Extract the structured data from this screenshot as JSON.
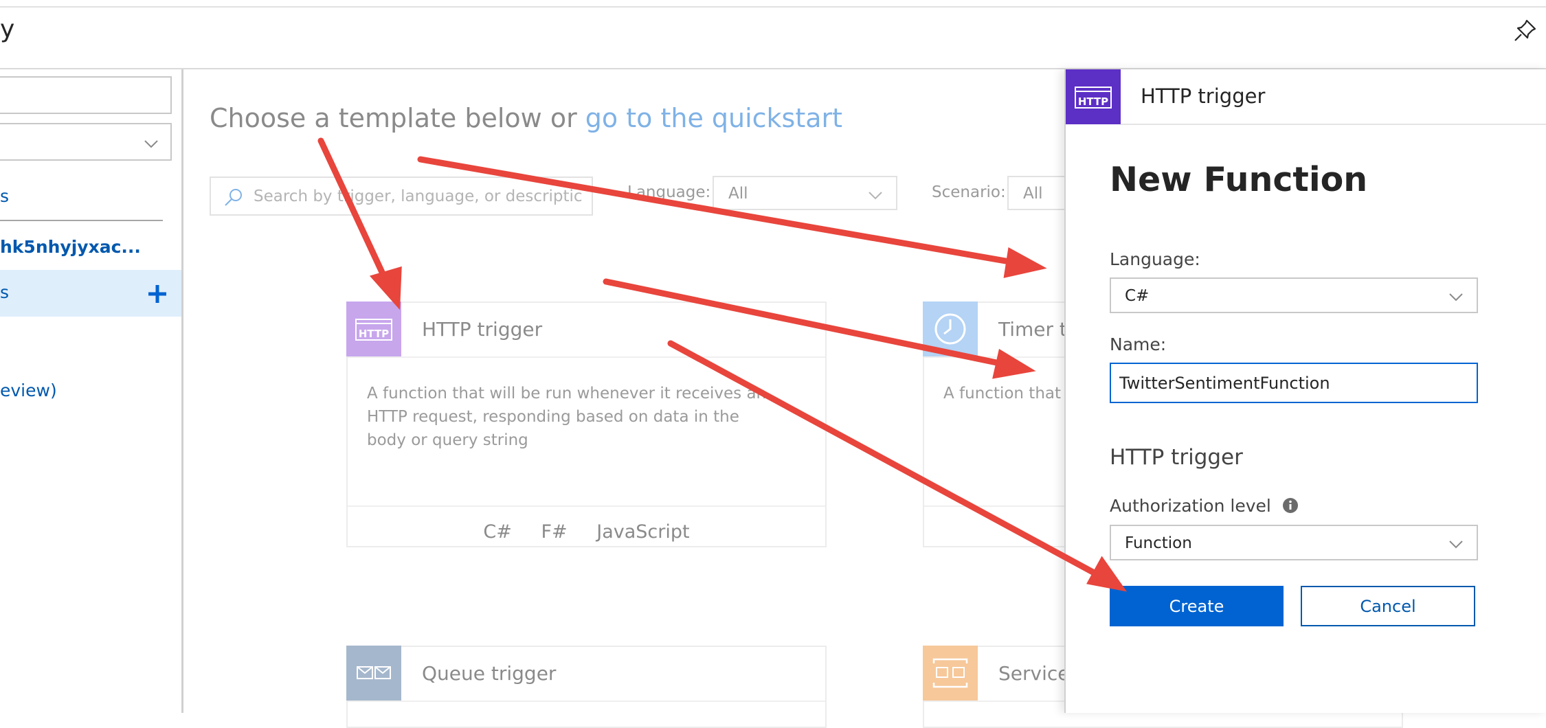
{
  "topbar": {
    "title_fragment": "y"
  },
  "sidebar": {
    "items": [
      {
        "label": "s"
      },
      {
        "label": "hk5nhyjyxac..."
      },
      {
        "label": "s"
      },
      {
        "label": "eview)"
      }
    ]
  },
  "main": {
    "heading_text": "Choose a template below or ",
    "heading_link": "go to the quickstart",
    "search_placeholder": "Search by trigger, language, or descriptic",
    "filter_language_label": "Language:",
    "filter_language_value": "All",
    "filter_scenario_label": "Scenario:",
    "filter_scenario_value": "All",
    "cards": [
      {
        "title": "HTTP trigger",
        "icon_text": "HTTP",
        "description": "A function that will be run whenever it receives an HTTP request, responding based on data in the body or query string",
        "languages": [
          "C#",
          "F#",
          "JavaScript"
        ]
      },
      {
        "title": "Timer tr",
        "description": "A function that w"
      },
      {
        "title": "Queue trigger"
      },
      {
        "title": "Service"
      }
    ]
  },
  "panel": {
    "header_title": "HTTP trigger",
    "header_icon_text": "HTTP",
    "title": "New Function",
    "language_label": "Language:",
    "language_value": "C#",
    "name_label": "Name:",
    "name_value": "TwitterSentimentFunction",
    "section_title": "HTTP trigger",
    "auth_label": "Authorization level",
    "auth_value": "Function",
    "create_label": "Create",
    "cancel_label": "Cancel"
  },
  "colors": {
    "accent_blue": "#0063d1",
    "http_purple": "#5c2fc5",
    "annotation_red": "#e8453c"
  }
}
